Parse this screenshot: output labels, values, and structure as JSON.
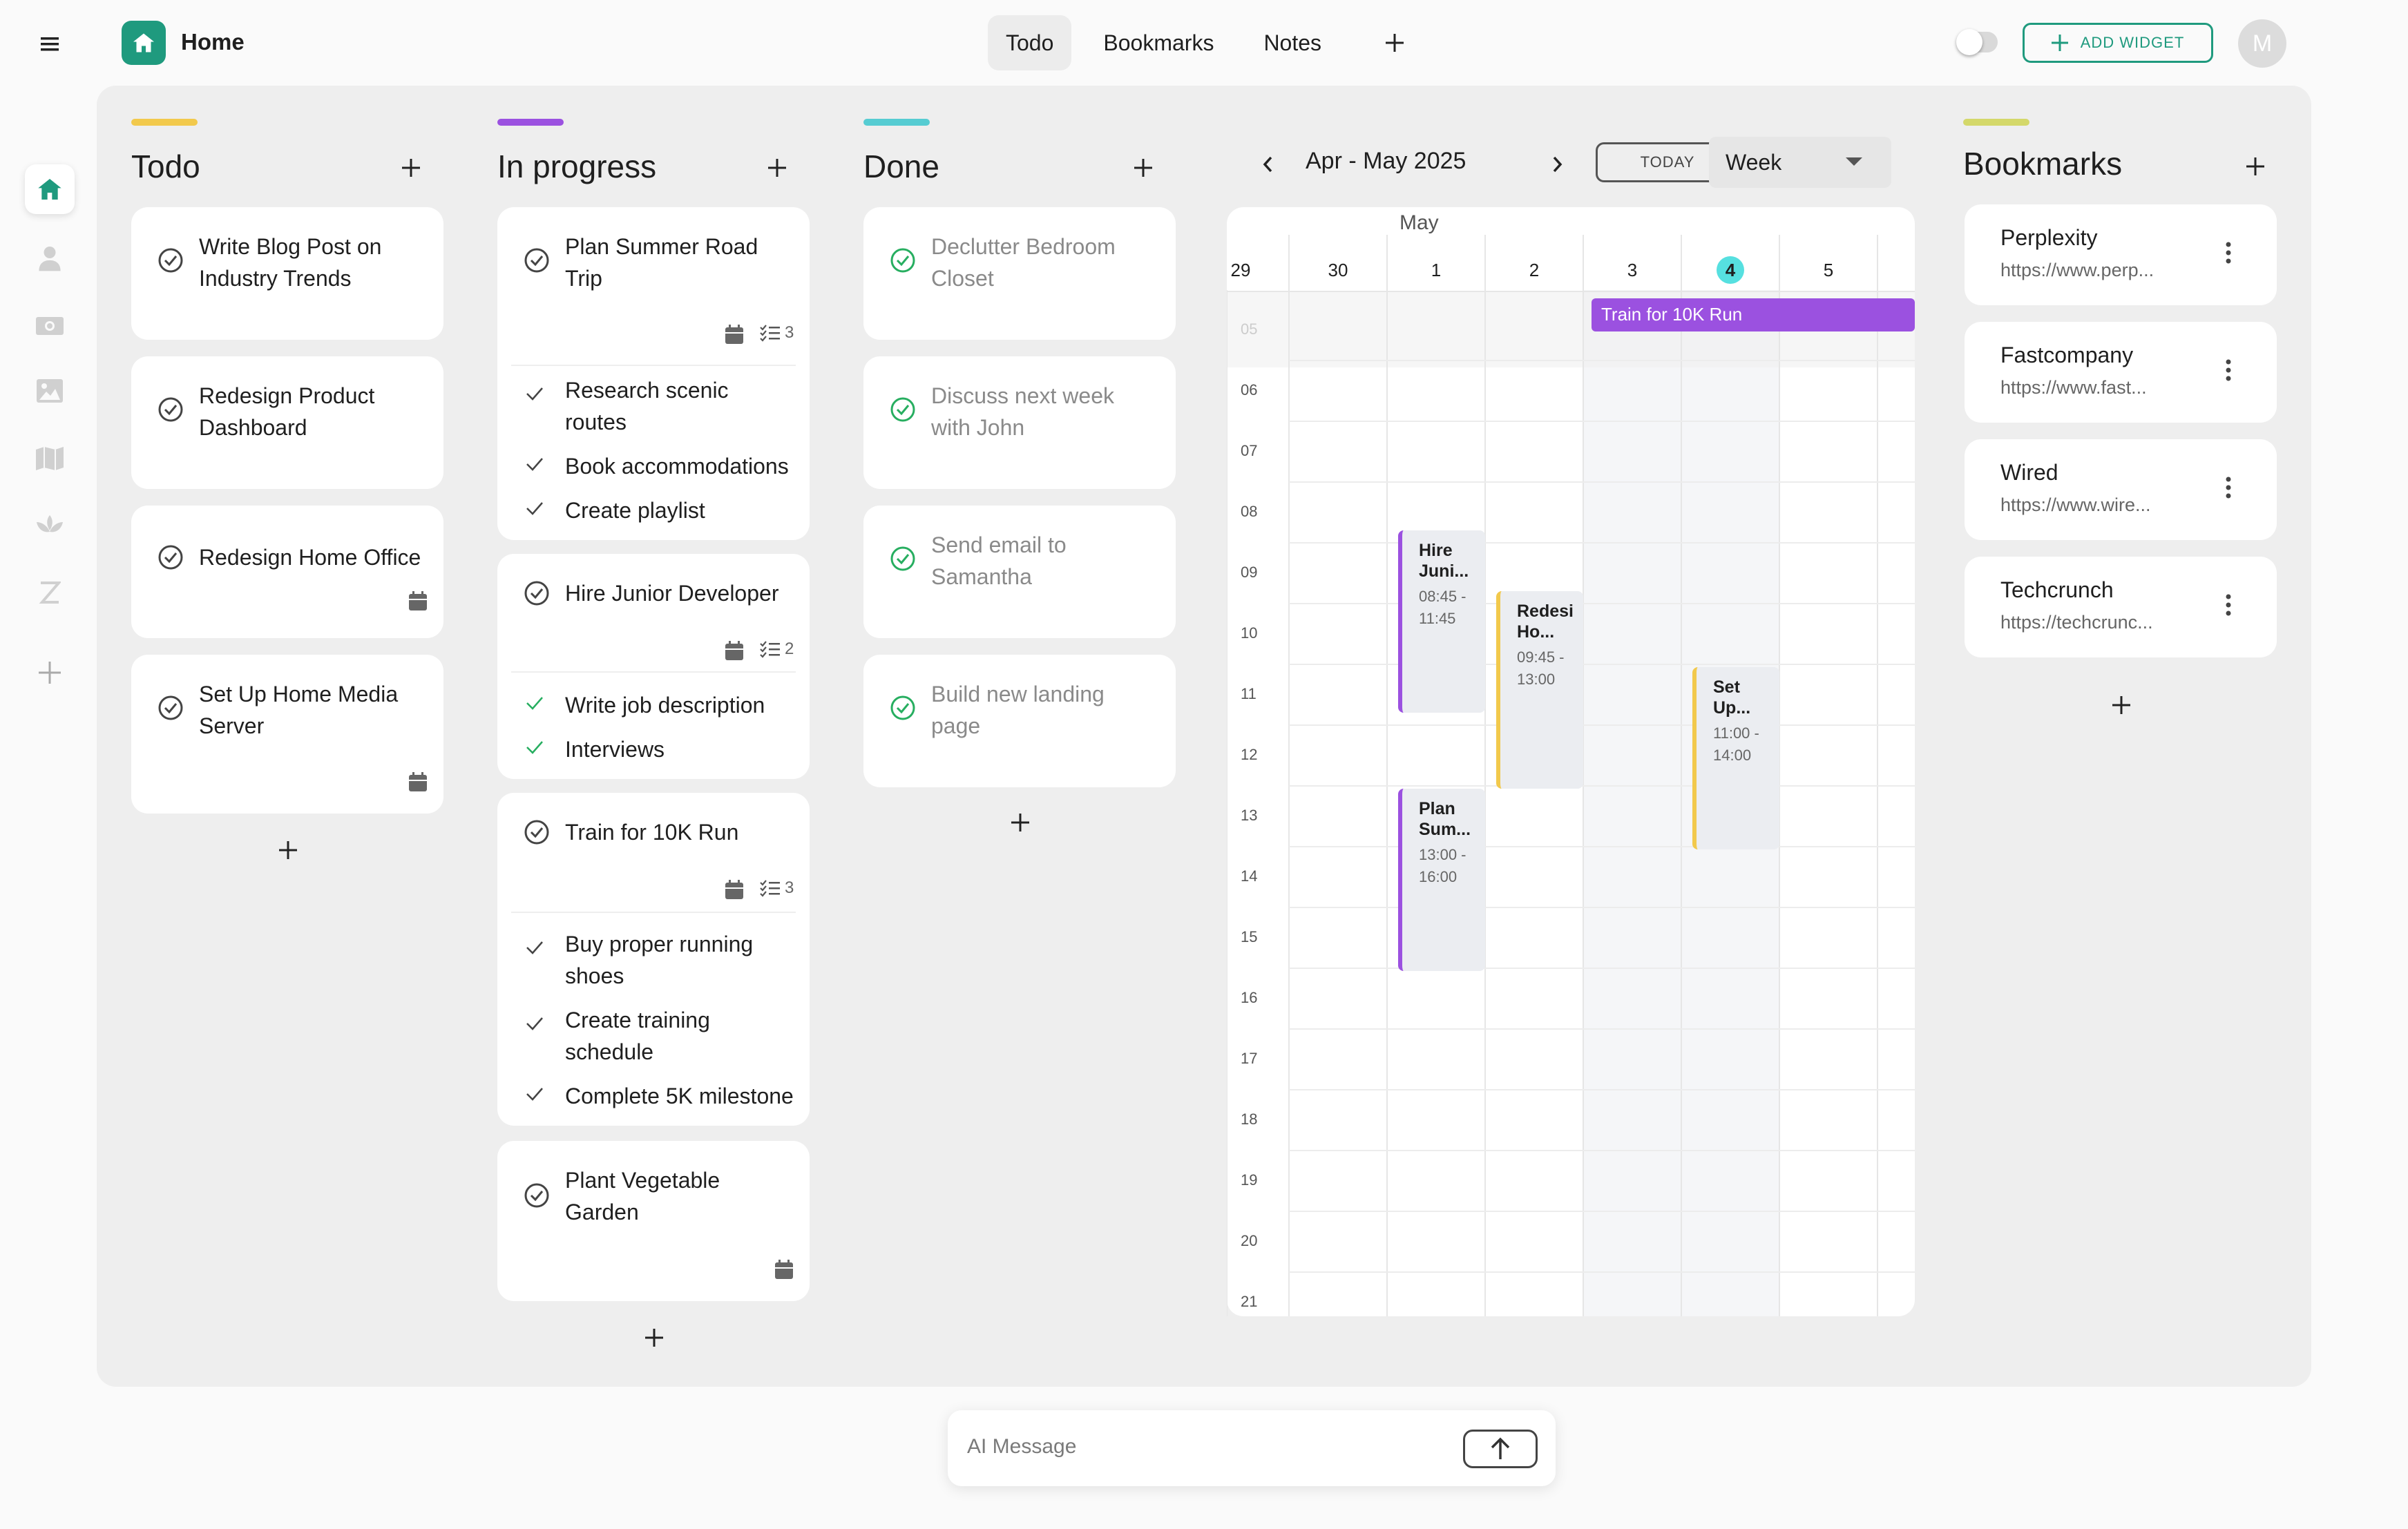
{
  "header": {
    "app_title": "Home",
    "tabs": [
      {
        "label": "Todo",
        "active": true
      },
      {
        "label": "Bookmarks",
        "active": false
      },
      {
        "label": "Notes",
        "active": false
      }
    ],
    "add_widget_label": "ADD WIDGET",
    "avatar_initial": "M"
  },
  "sidebar": {
    "icons": [
      "home-icon",
      "person-icon",
      "money-icon",
      "image-icon",
      "map-icon",
      "lotus-icon",
      "z-icon",
      "add-icon"
    ]
  },
  "columns": {
    "todo": {
      "title": "Todo",
      "accent": "#f2c94c",
      "cards": [
        {
          "title_1": "Write Blog Post on",
          "title_2": "Industry Trends"
        },
        {
          "title_1": "Redesign Product",
          "title_2": "Dashboard"
        },
        {
          "title_1": "Redesign Home Office"
        },
        {
          "title_1": "Set Up Home Media",
          "title_2": "Server"
        }
      ]
    },
    "in_progress": {
      "title": "In progress",
      "accent": "#9b51e0",
      "cards": [
        {
          "title_1": "Plan Summer Road",
          "title_2": "Trip",
          "subtask_count": "3",
          "subtasks": [
            {
              "line_1": "Research scenic",
              "line_2": "routes"
            },
            {
              "line_1": "Book accommodations"
            },
            {
              "line_1": "Create playlist"
            }
          ]
        },
        {
          "title_1": "Hire Junior Developer",
          "subtask_count": "2",
          "subtasks": [
            {
              "line_1": "Write job description"
            },
            {
              "line_1": "Interviews"
            }
          ]
        },
        {
          "title_1": "Train for 10K Run",
          "subtask_count": "3",
          "subtasks": [
            {
              "line_1": "Buy proper running",
              "line_2": "shoes"
            },
            {
              "line_1": "Create training",
              "line_2": "schedule"
            },
            {
              "line_1": "Complete 5K milestone"
            }
          ]
        },
        {
          "title_1": "Plant Vegetable",
          "title_2": "Garden"
        }
      ]
    },
    "done": {
      "title": "Done",
      "accent": "#56ccd2",
      "cards": [
        {
          "title_1": "Declutter Bedroom",
          "title_2": "Closet"
        },
        {
          "title_1": "Discuss next week",
          "title_2": "with John"
        },
        {
          "title_1": "Send email to",
          "title_2": "Samantha"
        },
        {
          "title_1": "Build new landing",
          "title_2": "page"
        }
      ]
    }
  },
  "calendar": {
    "range_label": "Apr - May 2025",
    "today_label": "TODAY",
    "view_label": "Week",
    "month_label": "May",
    "days": [
      "29",
      "30",
      "1",
      "2",
      "3",
      "4",
      "5"
    ],
    "today_day": "4",
    "hours": [
      "05",
      "06",
      "07",
      "08",
      "09",
      "10",
      "11",
      "12",
      "13",
      "14",
      "15",
      "16",
      "17",
      "18",
      "19",
      "20",
      "21"
    ],
    "all_day_event": "Train for 10K Run",
    "events": [
      {
        "title_1": "Hire",
        "title_2": "Juni...",
        "time_1": "08:45 -",
        "time_2": "11:45",
        "day": "1",
        "start": "08:45",
        "end": "11:45",
        "color": "#9b51e0"
      },
      {
        "title_1": "Redesi",
        "title_2": "Ho...",
        "time_1": "09:45 -",
        "time_2": "13:00",
        "day": "2",
        "start": "09:45",
        "end": "13:00",
        "color": "#f2c94c"
      },
      {
        "title_1": "Set",
        "title_2": "Up...",
        "time_1": "11:00 -",
        "time_2": "14:00",
        "day": "4",
        "start": "11:00",
        "end": "14:00",
        "color": "#f2c94c"
      },
      {
        "title_1": "Plan",
        "title_2": "Sum...",
        "time_1": "13:00 -",
        "time_2": "16:00",
        "day": "1",
        "start": "13:00",
        "end": "16:00",
        "color": "#9b51e0"
      }
    ],
    "colors": {
      "event_purple": "#9b51e0",
      "today_highlight": "#56e0e0"
    }
  },
  "bookmarks": {
    "title": "Bookmarks",
    "accent": "#d4d86a",
    "items": [
      {
        "name": "Perplexity",
        "url": "https://www.perp..."
      },
      {
        "name": "Fastcompany",
        "url": "https://www.fast..."
      },
      {
        "name": "Wired",
        "url": "https://www.wire..."
      },
      {
        "name": "Techcrunch",
        "url": "https://techcrunc..."
      }
    ]
  },
  "ai": {
    "placeholder": "AI Message"
  },
  "theme": {
    "brand": "#1f9a7e",
    "check_done": "#27ae60"
  }
}
